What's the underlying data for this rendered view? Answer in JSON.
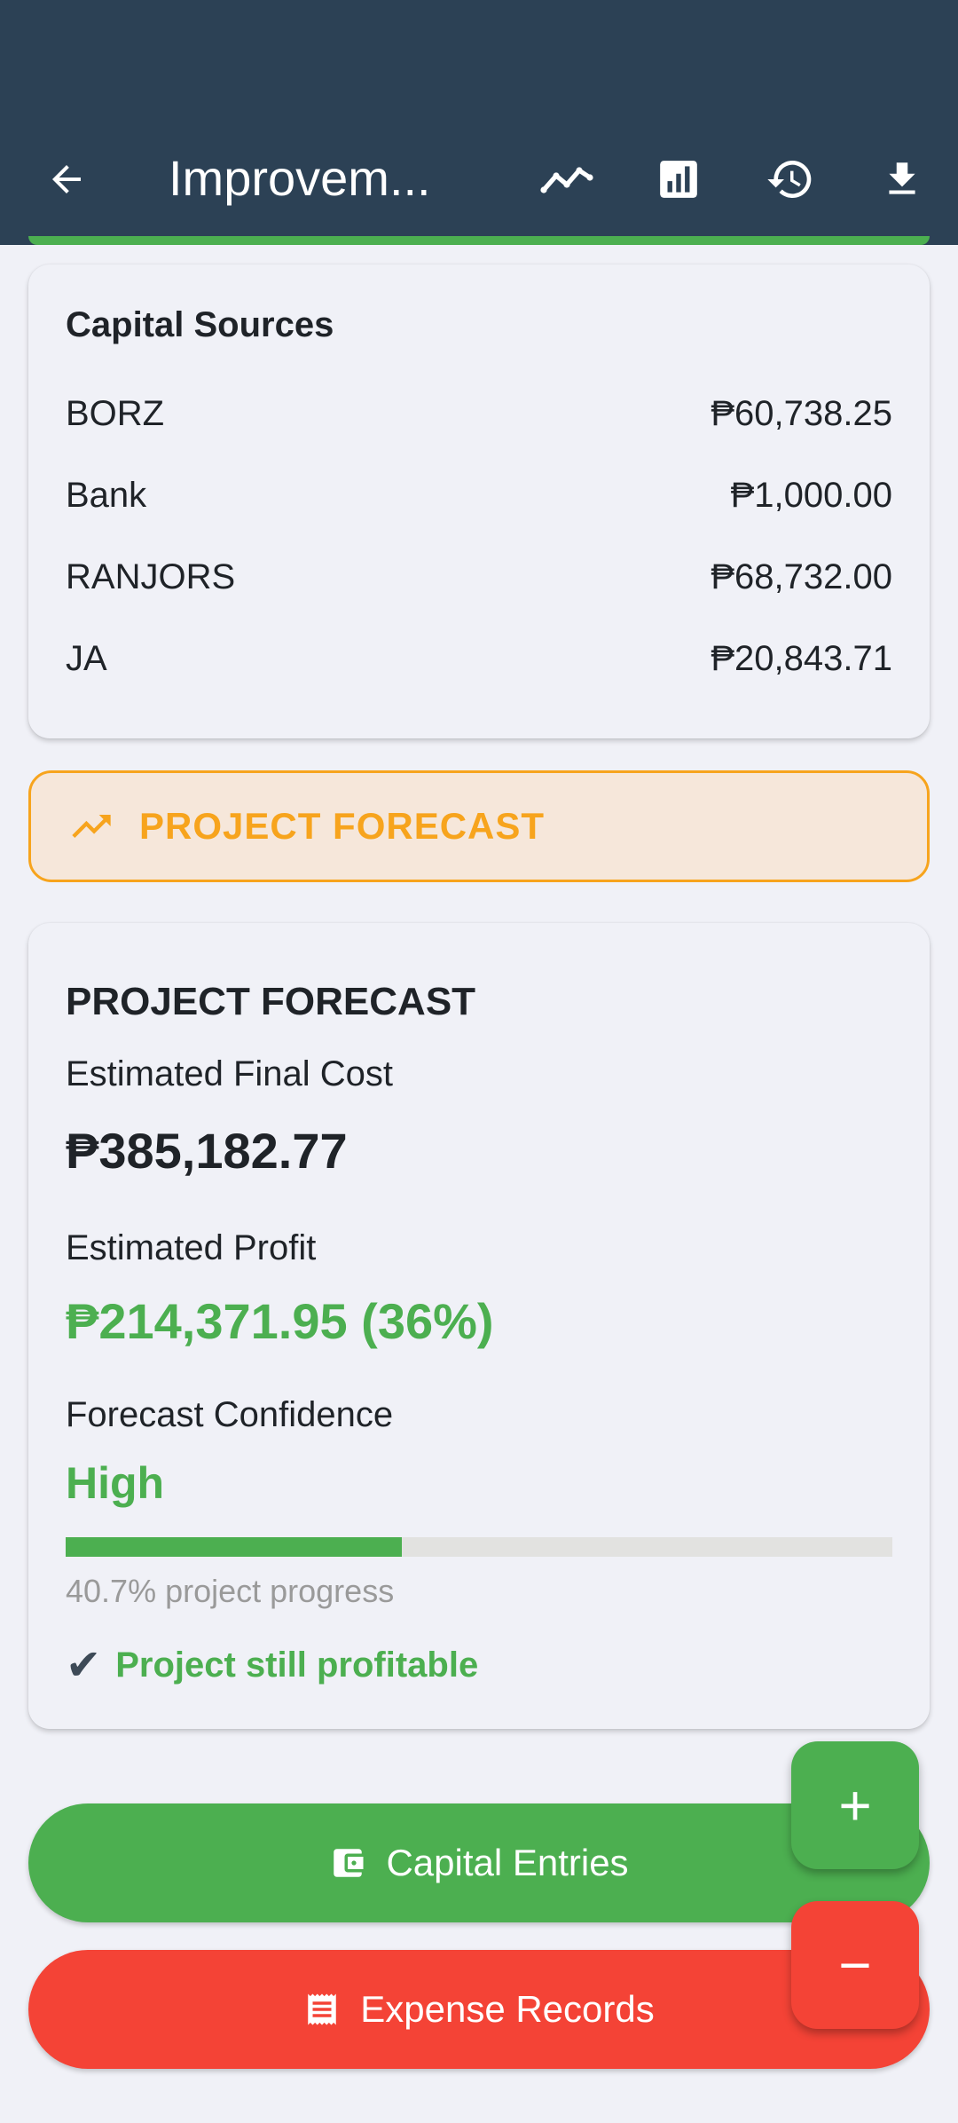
{
  "header": {
    "title": "Improvem...",
    "back_icon": "arrow-left-icon",
    "actions": [
      {
        "icon": "trend-line-icon"
      },
      {
        "icon": "bar-chart-icon"
      },
      {
        "icon": "history-icon"
      },
      {
        "icon": "download-icon"
      }
    ],
    "background": "#2c4155"
  },
  "capital_sources": {
    "title": "Capital Sources",
    "rows": [
      {
        "name": "BORZ",
        "amount": "₱60,738.25"
      },
      {
        "name": "Bank",
        "amount": "₱1,000.00"
      },
      {
        "name": "RANJORS",
        "amount": "₱68,732.00"
      },
      {
        "name": "JA",
        "amount": "₱20,843.71"
      }
    ]
  },
  "forecast_banner": {
    "label": "PROJECT FORECAST",
    "icon": "trending-up-icon",
    "color": "#f7a41d"
  },
  "forecast": {
    "title": "PROJECT FORECAST",
    "final_cost_label": "Estimated Final Cost",
    "final_cost_value": "₱385,182.77",
    "profit_label": "Estimated Profit",
    "profit_value": "₱214,371.95 (36%)",
    "confidence_label": "Forecast Confidence",
    "confidence_value": "High",
    "progress_percent": 40.7,
    "progress_text": "40.7% project progress",
    "profit_note_check": "✔",
    "profit_note": "Project still profitable",
    "accent": "#4caf50"
  },
  "buttons": {
    "capital_entries": "Capital Entries",
    "expense_records": "Expense Records",
    "fab_add": "+",
    "fab_remove": "−"
  }
}
